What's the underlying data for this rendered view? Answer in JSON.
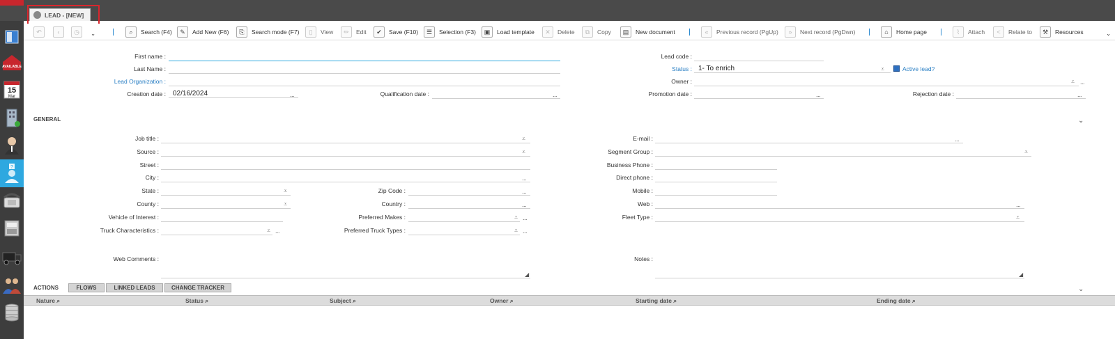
{
  "tab": {
    "title": "LEAD - [NEW]"
  },
  "sidebar": {
    "items": [
      {
        "icon": "window-icon"
      },
      {
        "icon": "available-sign-icon",
        "text": "AVAILABLE"
      },
      {
        "icon": "calendar-icon",
        "day": "15",
        "month": "Mar"
      },
      {
        "icon": "building-icon"
      },
      {
        "icon": "contact-icon"
      },
      {
        "icon": "lead-question-icon"
      },
      {
        "icon": "phone-icon"
      },
      {
        "icon": "cash-register-icon"
      },
      {
        "icon": "truck-icon"
      },
      {
        "icon": "people-icon"
      },
      {
        "icon": "database-icon"
      }
    ]
  },
  "toolbar": {
    "search": "Search (F4)",
    "add_new": "Add New (F6)",
    "search_mode": "Search mode (F7)",
    "view": "View",
    "edit": "Edit",
    "save": "Save (F10)",
    "selection": "Selection (F3)",
    "load_template": "Load template",
    "delete": "Delete",
    "copy": "Copy",
    "new_document": "New document",
    "previous_record": "Previous record (PgUp)",
    "next_record": "Next record (PgDwn)",
    "home_page": "Home page",
    "attach": "Attach",
    "relate_to": "Relate to",
    "resources": "Resources"
  },
  "header_form": {
    "first_name_label": "First name :",
    "last_name_label": "Last Name :",
    "lead_org_label": "Lead Organization :",
    "creation_date_label": "Creation date :",
    "creation_date_value": "02/16/2024",
    "qualification_date_label": "Qualification date :",
    "lead_code_label": "Lead code :",
    "status_label": "Status :",
    "status_value": "1- To enrich",
    "active_lead_label": "Active lead?",
    "owner_label": "Owner :",
    "promotion_date_label": "Promotion date :",
    "rejection_date_label": "Rejection date :"
  },
  "general": {
    "section_title": "GENERAL",
    "job_title_label": "Job title :",
    "source_label": "Source :",
    "street_label": "Street :",
    "city_label": "City :",
    "state_label": "State :",
    "zip_label": "Zip Code :",
    "county_label": "County :",
    "country_label": "Country :",
    "vehicle_label": "Vehicle of Interest :",
    "preferred_makes_label": "Preferred Makes :",
    "truck_char_label": "Truck Characteristics :",
    "preferred_truck_types_label": "Preferred Truck Types :",
    "web_comments_label": "Web Comments :",
    "email_label": "E-mail :",
    "segment_group_label": "Segment Group :",
    "business_phone_label": "Business Phone :",
    "direct_phone_label": "Direct phone :",
    "mobile_label": "Mobile :",
    "web_label": "Web :",
    "fleet_type_label": "Fleet Type :",
    "notes_label": "Notes :"
  },
  "bottom_tabs": {
    "actions": "ACTIONS",
    "flows": "FLOWS",
    "linked_leads": "LINKED LEADS",
    "change_tracker": "CHANGE TRACKER"
  },
  "grid": {
    "columns": [
      "Nature",
      "Status",
      "Subject",
      "Owner",
      "Starting date",
      "Ending date"
    ]
  },
  "colors": {
    "accent": "#2ea8e0",
    "link": "#2a7fc4",
    "highlight_box": "#d9262d",
    "topbar": "#4a4a4a",
    "sidebar": "#3d3d3d"
  }
}
